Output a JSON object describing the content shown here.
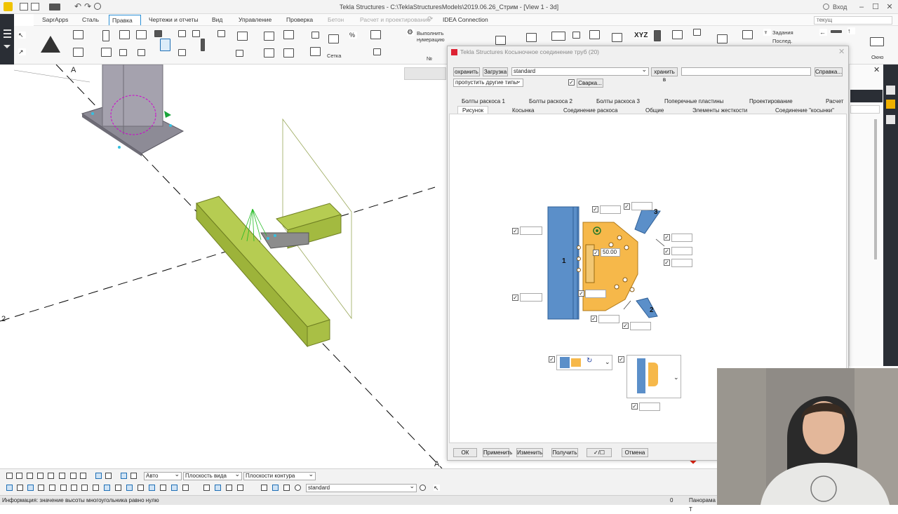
{
  "window": {
    "title": "Tekla Structures - C:\\TeklaStructuresModels\\2019.06.26_Стрим - [View 1 - 3d]",
    "login_label": "Вход"
  },
  "menu": {
    "tabs": [
      "SaprApps",
      "Сталь",
      "Правка",
      "Чертежи и отчеты",
      "Вид",
      "Управление",
      "Проверка",
      "Бетон",
      "Расчет и проектирование",
      "IDEA Connection"
    ],
    "active_tab": "Правка",
    "search_placeholder": "текущ"
  },
  "ribbon": {
    "run_numbering_line1": "Выполнить",
    "run_numbering_line2": "нумерацию",
    "grid_label": "Сетка",
    "number_label": "№",
    "tasks_label": "Задания",
    "next_label": "Послед.",
    "window_label": "Окно"
  },
  "viewport": {
    "axis_label_a_top": "A",
    "axis_label_a_bottom": "A",
    "axis_label_2": "2"
  },
  "dialog": {
    "title": "Tekla Structures  Косыночное соединение труб (20)",
    "save_button": "охранить",
    "load_button": "Загрузка",
    "preset_value": "standard",
    "save_as_button": "хранить в",
    "save_as_value": "",
    "help_button": "Справка...",
    "skip_types_value": "пропустить другие типы",
    "weld_button": "Сварка...",
    "tabs_row1": [
      "Болты раскоса 1",
      "Болты раскоса 2",
      "Болты раскоса 3",
      "Поперечные пластины",
      "Проектирование",
      "Расчет"
    ],
    "tabs_row2": [
      "Рисунок",
      "Косынка",
      "Соединение раскоса",
      "Общие",
      "Элементы жесткости",
      "Соединение \"косынки\""
    ],
    "selected_tab": "Рисунок",
    "picture": {
      "dimension_value": "50.00",
      "member_label_1": "1",
      "member_label_2": "2",
      "member_label_3": "3"
    },
    "footer": {
      "ok": "ОК",
      "apply": "Применить",
      "modify": "Изменить",
      "get": "Получить",
      "toggle": "✓/☐",
      "cancel": "Отмена"
    }
  },
  "bottom_toolbar": {
    "snap_mode": "Авто",
    "view_plane": "Плоскость вида",
    "contour_plane": "Плоскости контура",
    "preset": "standard"
  },
  "status": {
    "message": "Информация: значение высоты многоугольника равно нулю",
    "counter": "0",
    "pan_label": "Панорама Т"
  },
  "colors": {
    "gusset": "#f6b84a",
    "chord": "#5b8fc9",
    "beam": "#b0c74a",
    "accent": "#2a8fd6",
    "dark_strip": "#2a2e35"
  }
}
